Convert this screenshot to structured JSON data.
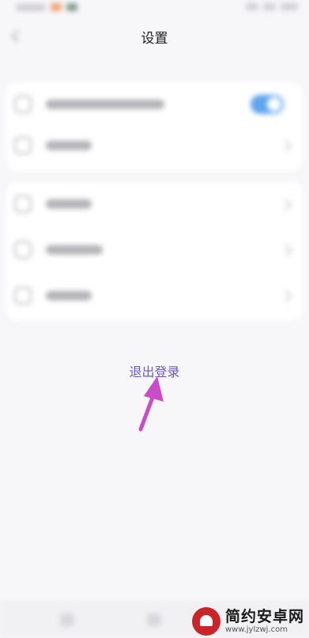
{
  "header": {
    "title": "设置"
  },
  "actions": {
    "logout_label": "退出登录"
  },
  "watermark": {
    "title": "简约安卓网",
    "url": "www.jylzwj.com"
  },
  "colors": {
    "logout_text": "#6e56c4",
    "arrow": "#c94cc9",
    "toggle_on": "#5fa4ec",
    "background": "#f7f6f9",
    "card": "#ffffff",
    "watermark_logo": "#c8242a"
  },
  "icons": [
    "back-icon",
    "chevron-right-icon",
    "arrow-annotation-icon",
    "android-logo-icon"
  ]
}
